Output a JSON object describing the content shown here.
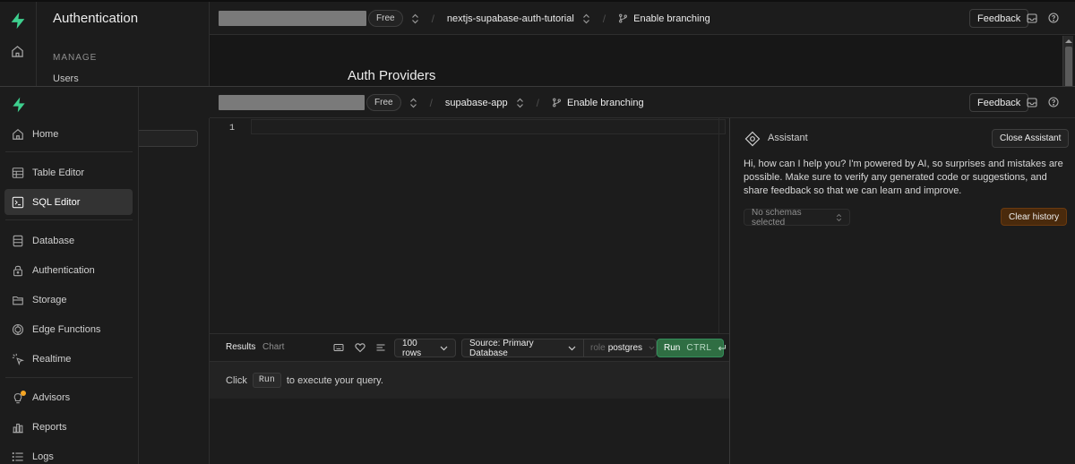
{
  "background_window": {
    "section_title": "Authentication",
    "manage_label": "MANAGE",
    "users_label": "Users",
    "page_heading": "Auth Providers",
    "plan_badge": "Free",
    "project_name": "nextjs-supabase-auth-tutorial",
    "branching_label": "Enable branching",
    "feedback_label": "Feedback"
  },
  "topbar": {
    "plan_badge": "Free",
    "project_name": "supabase-app",
    "branching_label": "Enable branching",
    "feedback_label": "Feedback"
  },
  "sidebar": {
    "items": [
      {
        "label": "Home",
        "icon": "home-icon"
      },
      {
        "label": "Table Editor",
        "icon": "table-icon"
      },
      {
        "label": "SQL Editor",
        "icon": "terminal-icon",
        "active": true
      },
      {
        "label": "Database",
        "icon": "database-icon"
      },
      {
        "label": "Authentication",
        "icon": "lock-icon"
      },
      {
        "label": "Storage",
        "icon": "archive-icon"
      },
      {
        "label": "Edge Functions",
        "icon": "function-icon"
      },
      {
        "label": "Realtime",
        "icon": "cursor-icon"
      },
      {
        "label": "Advisors",
        "icon": "lightbulb-icon"
      },
      {
        "label": "Reports",
        "icon": "chart-icon"
      },
      {
        "label": "Logs",
        "icon": "list-icon"
      }
    ]
  },
  "editor": {
    "line_numbers": [
      "1"
    ]
  },
  "results_bar": {
    "tabs": [
      "Results",
      "Chart"
    ],
    "rows_select": "100 rows",
    "source_select": "Source: Primary Database",
    "role_label": "role",
    "role_value": "postgres",
    "run_label": "Run",
    "run_shortcut": "CTRL"
  },
  "results": {
    "message_prefix": "Click",
    "run_chip": "Run",
    "message_suffix": "to execute your query."
  },
  "assistant": {
    "title": "Assistant",
    "close_label": "Close Assistant",
    "intro_text": "Hi, how can I help you? I'm powered by AI, so surprises and mistakes are possible. Make sure to verify any generated code or suggestions, and share feedback so that we can learn and improve.",
    "schema_select": "No schemas selected",
    "clear_history_label": "Clear history"
  },
  "colors": {
    "brand_green": "#3ecf8e",
    "run_button": "#2f6e43",
    "clear_history": "#4a2a0c",
    "background": "#1c1c1c"
  }
}
